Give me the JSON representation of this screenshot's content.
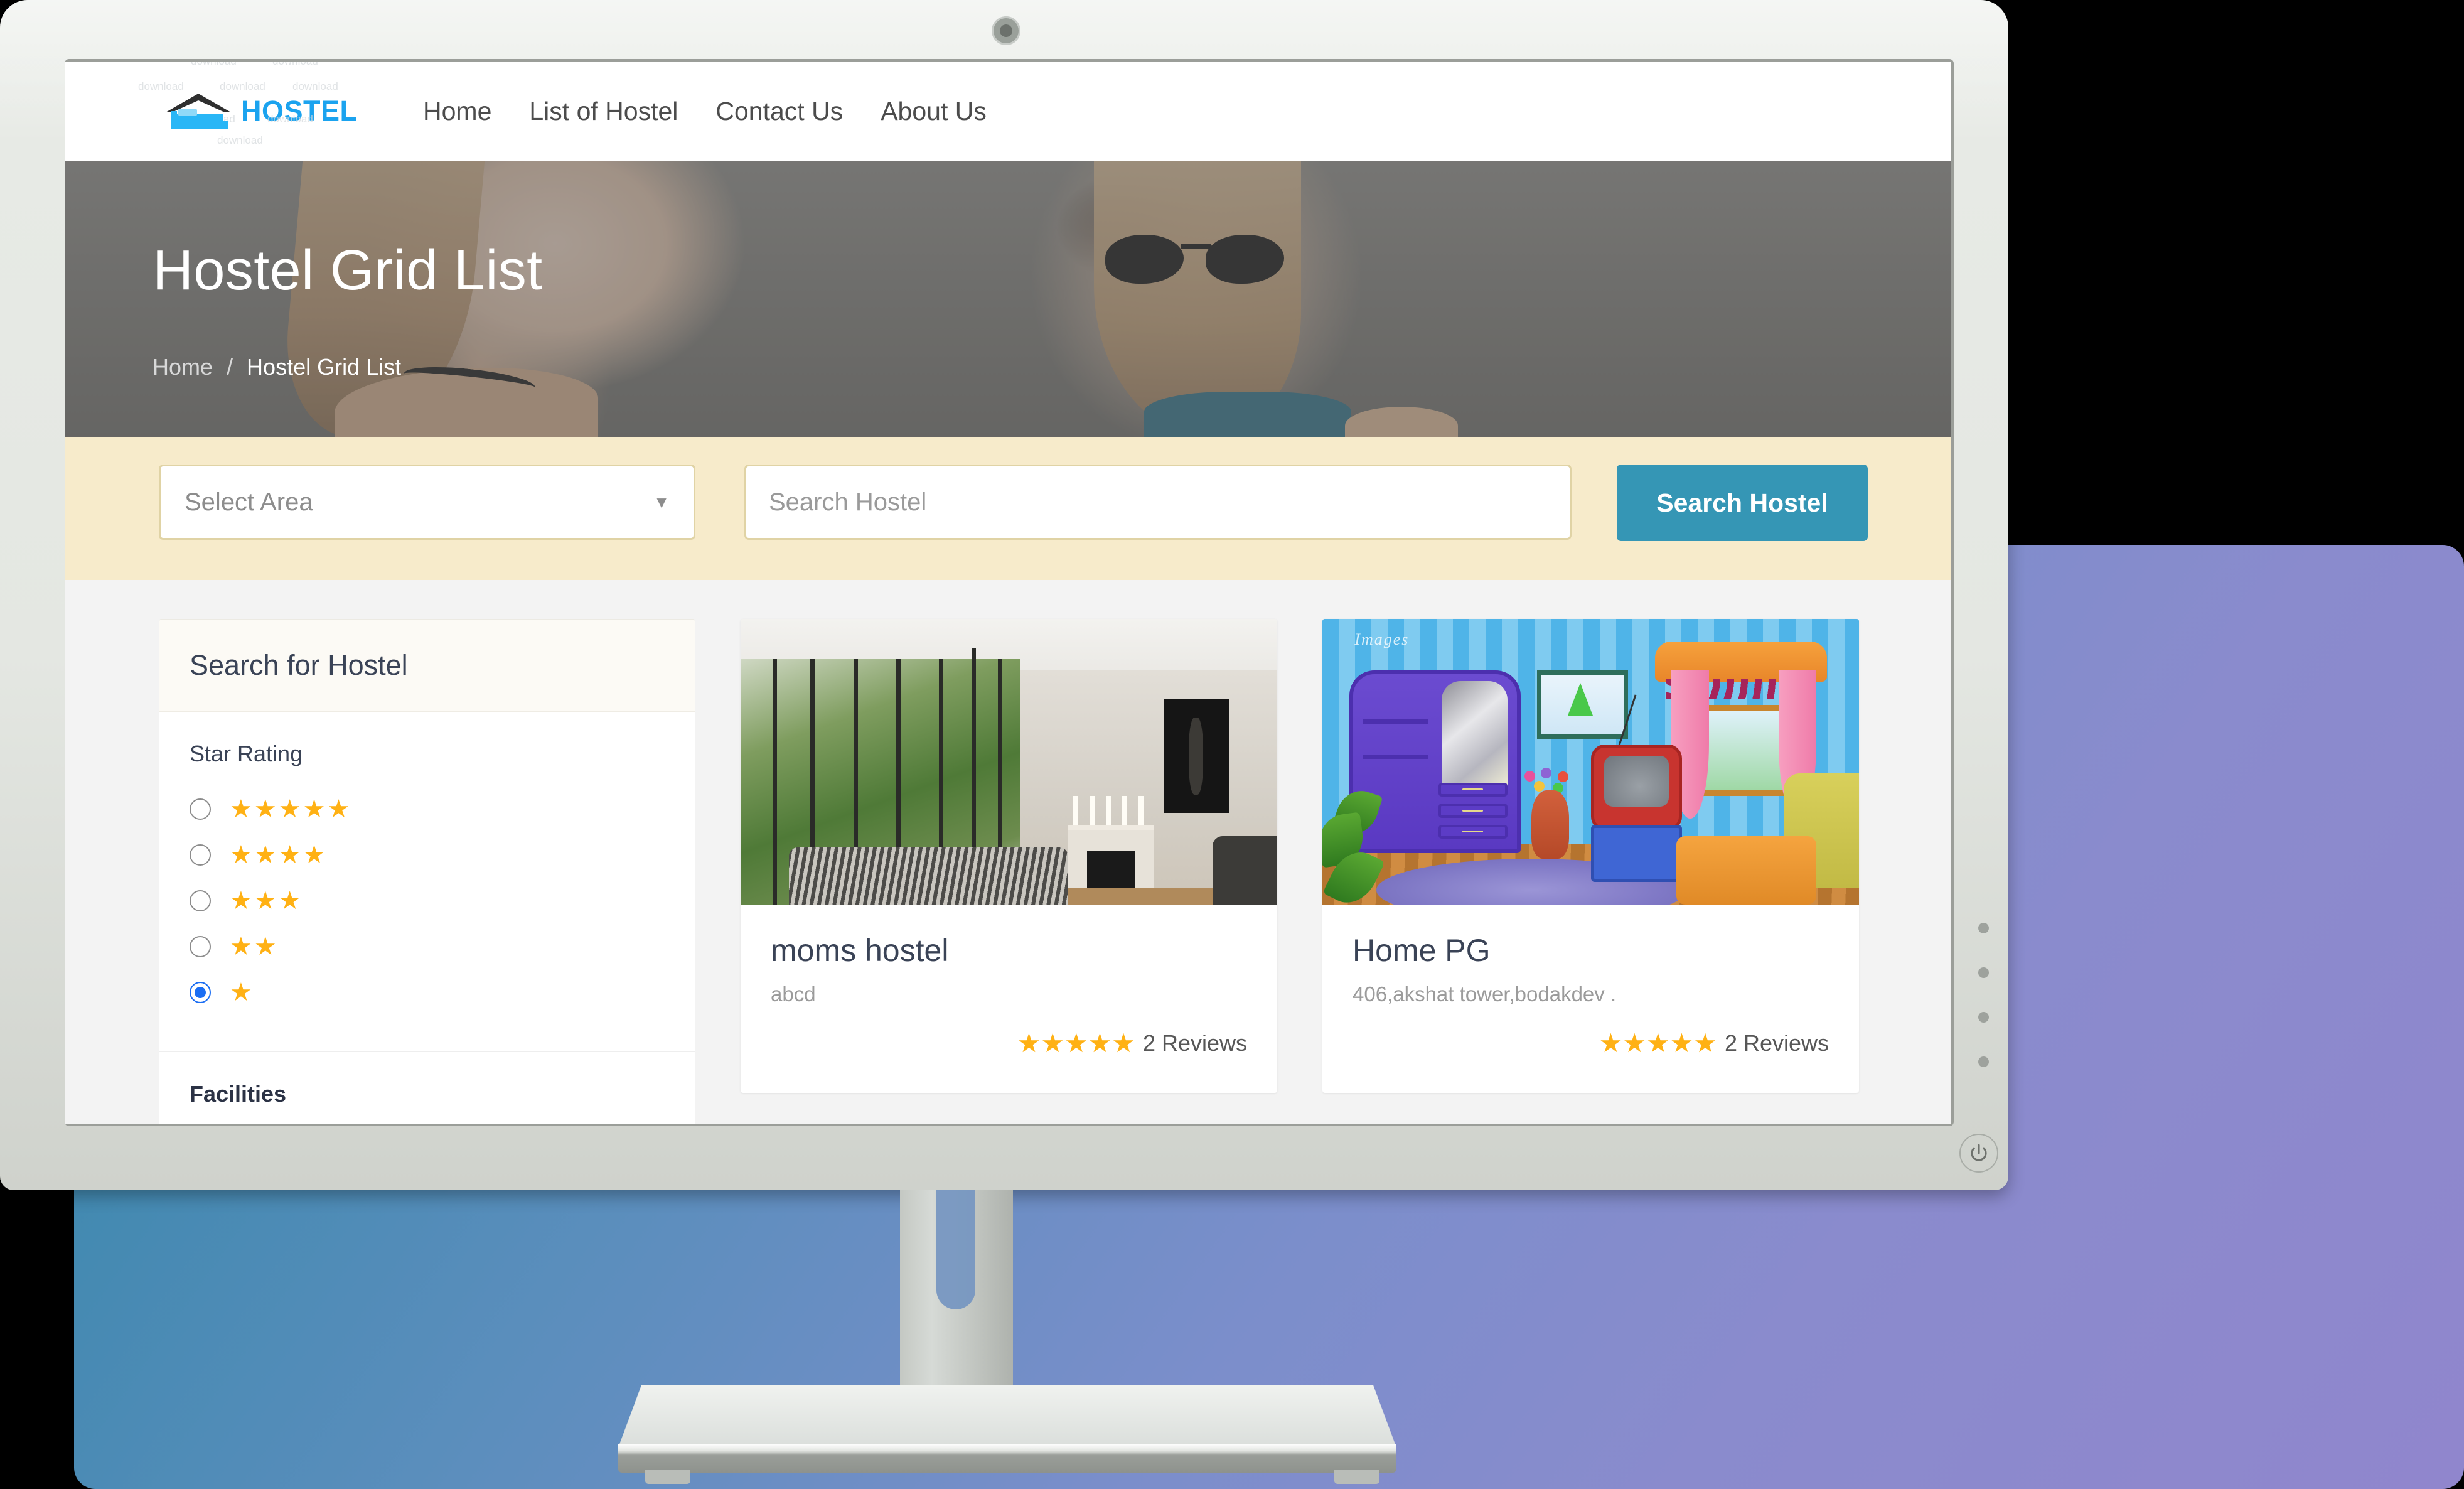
{
  "site": {
    "logo_text": "HOSTEL",
    "logo_icon": "house-with-bed-icon",
    "watermarks": [
      "download",
      "download",
      "download",
      "download",
      "download",
      "download",
      "download",
      "download"
    ]
  },
  "nav": {
    "items": [
      {
        "label": "Home"
      },
      {
        "label": "List of Hostel"
      },
      {
        "label": "Contact Us"
      },
      {
        "label": "About Us"
      }
    ]
  },
  "hero": {
    "title": "Hostel Grid List",
    "breadcrumb": {
      "home": "Home",
      "separator": "/",
      "current": "Hostel Grid List"
    }
  },
  "searchband": {
    "select_area_placeholder": "Select Area",
    "search_placeholder": "Search Hostel",
    "search_value": "",
    "button_label": "Search Hostel",
    "button_color": "#3596b5",
    "band_color": "#f7ebcb"
  },
  "sidebar": {
    "title": "Search for Hostel",
    "star_rating_label": "Star Rating",
    "star_color": "#ffb114",
    "ratings": [
      {
        "stars": "★★★★★",
        "count": 5,
        "selected": false
      },
      {
        "stars": "★★★★",
        "count": 4,
        "selected": false
      },
      {
        "stars": "★★★",
        "count": 3,
        "selected": false
      },
      {
        "stars": "★★",
        "count": 2,
        "selected": false
      },
      {
        "stars": "★",
        "count": 1,
        "selected": true
      }
    ],
    "facilities_label": "Facilities"
  },
  "cards": [
    {
      "title": "moms hostel",
      "subtitle": "abcd",
      "stars": "★★★★★",
      "reviews": "2 Reviews",
      "image_alt": "modern-glass-living-room-photo"
    },
    {
      "title": "Home PG",
      "subtitle": "406,akshat tower,bodakdev .",
      "stars": "★★★★★",
      "reviews": "2 Reviews",
      "image_alt": "cartoon-bedroom-illustration",
      "image_watermark": "Images"
    }
  ],
  "monitor": {
    "power_icon": "power-icon",
    "webcam_icon": "webcam-icon",
    "side_buttons": [
      "control-dot",
      "control-dot",
      "control-dot",
      "control-dot"
    ]
  }
}
